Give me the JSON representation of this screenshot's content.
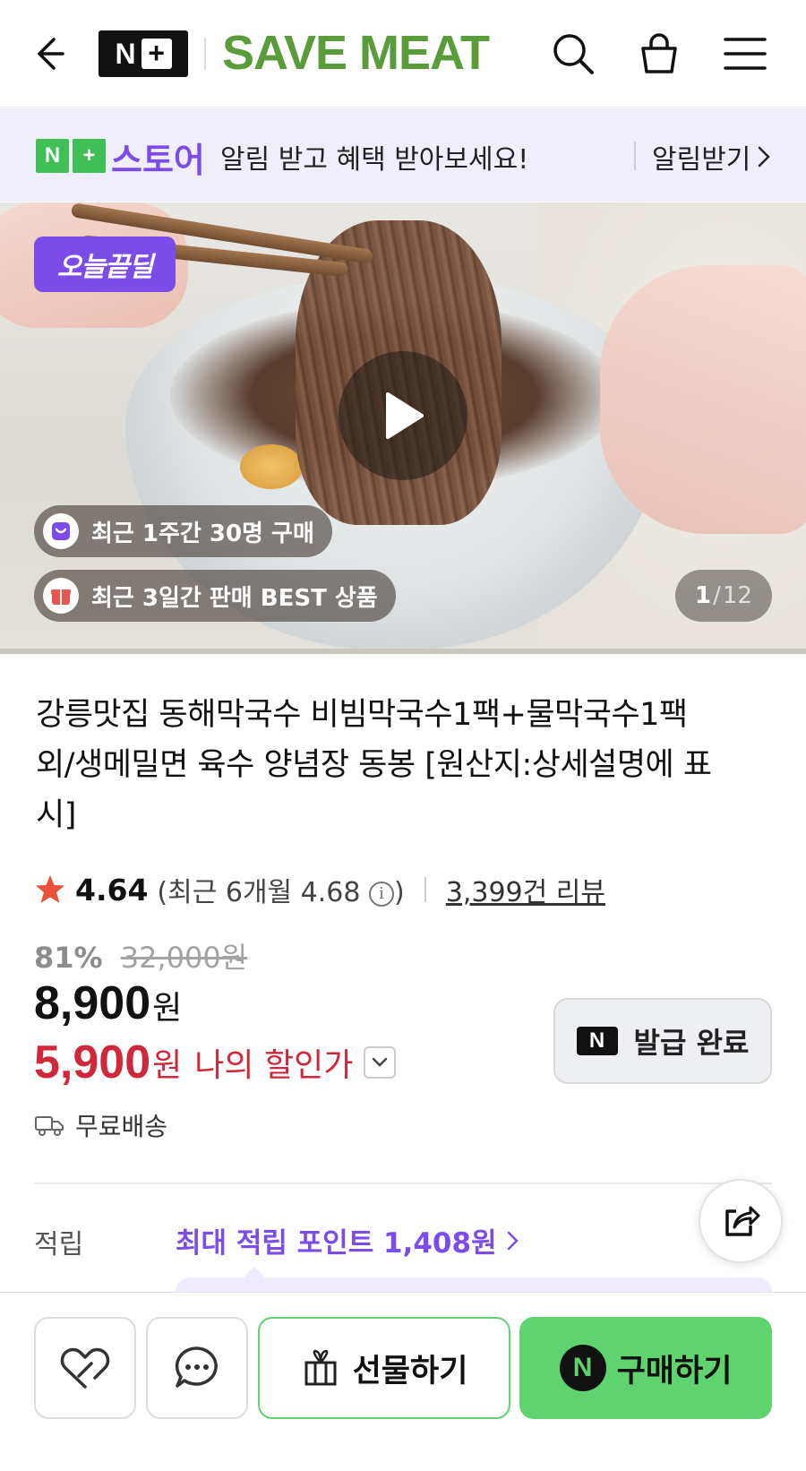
{
  "header": {
    "logo_n": "N",
    "logo_plus": "+",
    "brand": "SAVE MEAT"
  },
  "store_banner": {
    "logo_n": "N",
    "logo_plus": "+",
    "store_name": "스토어",
    "message": "알림 받고 혜택 받아보세요!",
    "action_label": "알림받기"
  },
  "media": {
    "deal_badge": "오늘끝딜",
    "recent_purchases": "최근 1주간 30명 구매",
    "best_label": "최근 3일간 판매 BEST 상품",
    "current_index": "1",
    "total_count": "12"
  },
  "product": {
    "title": "강릉맛집 동해막국수 비빔막국수1팩+물막국수1팩 외/생메밀면 육수 양념장 동봉 [원산지:상세설명에 표시]",
    "rating": "4.64",
    "recent_rating_prefix": "(최근 6개월 4.68",
    "recent_rating_suffix": ")",
    "review_count": "3,399건 리뷰",
    "discount_percent": "81%",
    "original_price": "32,000원",
    "price": "8,900",
    "price_unit": "원",
    "my_price": "5,900",
    "my_price_unit": "원",
    "my_price_label": "나의 할인가",
    "coupon_mark": "N",
    "coupon_status": "발급 완료",
    "shipping": "무료배송",
    "points_label": "적립",
    "points_value": "최대 적립 포인트 1,408원"
  },
  "bottom_bar": {
    "gift_label": "선물하기",
    "buy_mark": "N",
    "buy_label": "구매하기"
  },
  "colors": {
    "brand_green": "#5a9b3a",
    "store_purple": "#7b4ce8",
    "sale_red": "#d0283a",
    "naver_green": "#5fd36e"
  }
}
